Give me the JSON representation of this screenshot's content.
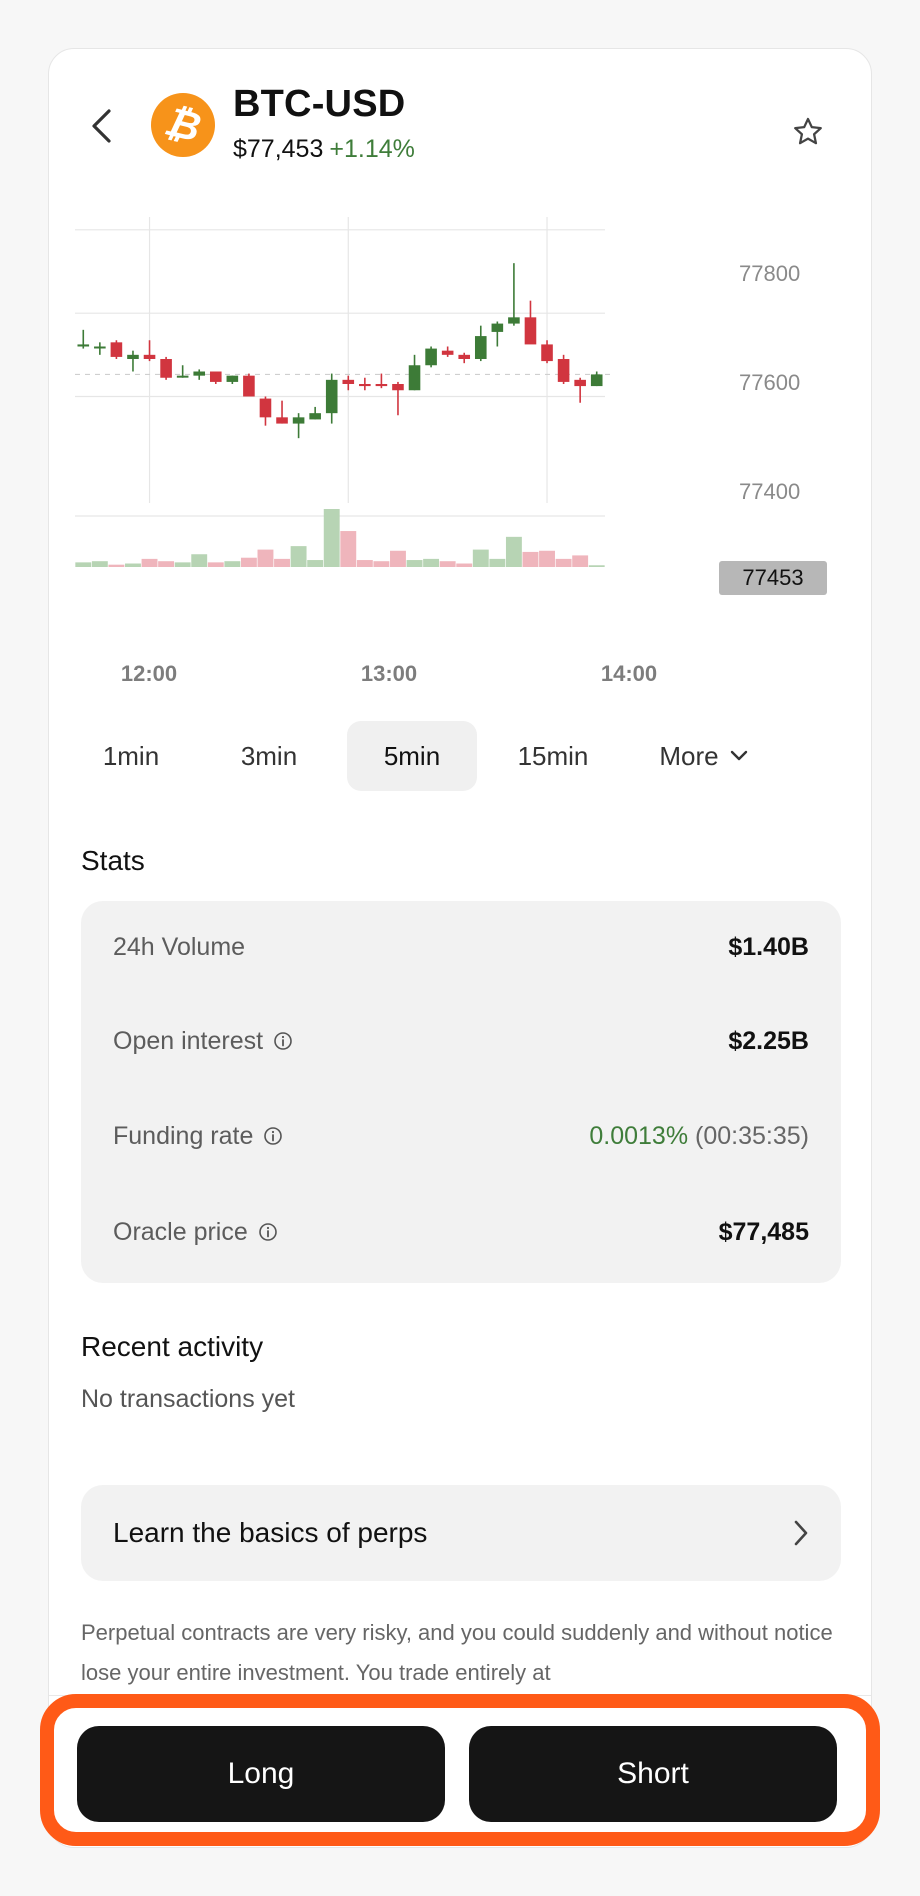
{
  "header": {
    "symbol": "BTC-USD",
    "coin_glyph": "₿",
    "price": "$77,453",
    "change": "+1.14%",
    "back_icon": "chevron-left-icon",
    "favorite_icon": "star-outline-icon",
    "coin_icon": "bitcoin-logo"
  },
  "chart_data": {
    "type": "candlestick",
    "y_ticks": [
      "77800",
      "77600",
      "77400"
    ],
    "ylim": [
      77130,
      77850
    ],
    "x_ticks": [
      "12:00",
      "13:00",
      "14:00"
    ],
    "last_price_label": "77453",
    "last_price": 77453,
    "interval": "5min",
    "colors": {
      "up": "#3d7b37",
      "down": "#d1353f",
      "up_volume": "#b7d4b4",
      "down_volume": "#efb5bc"
    },
    "candles": [
      {
        "t": "11:40",
        "o": 77520,
        "h": 77560,
        "l": 77515,
        "c": 77525
      },
      {
        "t": "11:45",
        "o": 77520,
        "h": 77530,
        "l": 77500,
        "c": 77520
      },
      {
        "t": "11:50",
        "o": 77530,
        "h": 77535,
        "l": 77490,
        "c": 77495
      },
      {
        "t": "11:55",
        "o": 77490,
        "h": 77510,
        "l": 77460,
        "c": 77500
      },
      {
        "t": "12:00",
        "o": 77500,
        "h": 77535,
        "l": 77485,
        "c": 77490
      },
      {
        "t": "12:05",
        "o": 77490,
        "h": 77495,
        "l": 77440,
        "c": 77445
      },
      {
        "t": "12:10",
        "o": 77450,
        "h": 77475,
        "l": 77445,
        "c": 77450
      },
      {
        "t": "12:15",
        "o": 77450,
        "h": 77465,
        "l": 77440,
        "c": 77460
      },
      {
        "t": "12:20",
        "o": 77460,
        "h": 77460,
        "l": 77430,
        "c": 77435
      },
      {
        "t": "12:25",
        "o": 77435,
        "h": 77450,
        "l": 77430,
        "c": 77450
      },
      {
        "t": "12:30",
        "o": 77450,
        "h": 77455,
        "l": 77400,
        "c": 77400
      },
      {
        "t": "12:35",
        "o": 77395,
        "h": 77400,
        "l": 77330,
        "c": 77350
      },
      {
        "t": "12:40",
        "o": 77350,
        "h": 77390,
        "l": 77335,
        "c": 77335
      },
      {
        "t": "12:45",
        "o": 77335,
        "h": 77360,
        "l": 77300,
        "c": 77350
      },
      {
        "t": "12:50",
        "o": 77345,
        "h": 77375,
        "l": 77345,
        "c": 77360
      },
      {
        "t": "12:55",
        "o": 77360,
        "h": 77455,
        "l": 77335,
        "c": 77440
      },
      {
        "t": "13:00",
        "o": 77440,
        "h": 77450,
        "l": 77415,
        "c": 77430
      },
      {
        "t": "13:05",
        "o": 77430,
        "h": 77445,
        "l": 77415,
        "c": 77425
      },
      {
        "t": "13:10",
        "o": 77430,
        "h": 77455,
        "l": 77420,
        "c": 77425
      },
      {
        "t": "13:15",
        "o": 77430,
        "h": 77435,
        "l": 77355,
        "c": 77415
      },
      {
        "t": "13:20",
        "o": 77415,
        "h": 77500,
        "l": 77415,
        "c": 77475
      },
      {
        "t": "13:25",
        "o": 77475,
        "h": 77520,
        "l": 77470,
        "c": 77515
      },
      {
        "t": "13:30",
        "o": 77510,
        "h": 77520,
        "l": 77495,
        "c": 77500
      },
      {
        "t": "13:35",
        "o": 77500,
        "h": 77505,
        "l": 77480,
        "c": 77490
      },
      {
        "t": "13:40",
        "o": 77490,
        "h": 77570,
        "l": 77485,
        "c": 77545
      },
      {
        "t": "13:45",
        "o": 77555,
        "h": 77580,
        "l": 77520,
        "c": 77575
      },
      {
        "t": "13:50",
        "o": 77575,
        "h": 77720,
        "l": 77570,
        "c": 77590
      },
      {
        "t": "13:55",
        "o": 77590,
        "h": 77630,
        "l": 77530,
        "c": 77525
      },
      {
        "t": "14:00",
        "o": 77525,
        "h": 77535,
        "l": 77480,
        "c": 77485
      },
      {
        "t": "14:05",
        "o": 77490,
        "h": 77500,
        "l": 77430,
        "c": 77435
      },
      {
        "t": "14:10",
        "o": 77440,
        "h": 77445,
        "l": 77385,
        "c": 77425
      },
      {
        "t": "14:15",
        "o": 77425,
        "h": 77460,
        "l": 77425,
        "c": 77453
      }
    ],
    "volumes": [
      8,
      10,
      4,
      6,
      14,
      10,
      8,
      22,
      8,
      10,
      16,
      30,
      14,
      36,
      12,
      100,
      62,
      12,
      10,
      28,
      12,
      14,
      10,
      6,
      30,
      14,
      52,
      26,
      28,
      14,
      20,
      3
    ]
  },
  "intervals": {
    "options": [
      "1min",
      "3min",
      "5min",
      "15min",
      "More"
    ],
    "selected": "5min",
    "more_icon": "chevron-down-icon"
  },
  "stats": {
    "title": "Stats",
    "volume_label": "24h Volume",
    "volume_value": "$1.40B",
    "oi_label": "Open interest",
    "oi_value": "$2.25B",
    "funding_label": "Funding rate",
    "funding_value": "0.0013%",
    "funding_timer": "(00:35:35)",
    "oracle_label": "Oracle price",
    "oracle_value": "$77,485",
    "info_icon": "info-circle-icon"
  },
  "activity": {
    "title": "Recent activity",
    "empty": "No transactions yet"
  },
  "learn": {
    "label": "Learn the basics of perps",
    "icon": "chevron-right-icon"
  },
  "disclaimer": "Perpetual contracts are very risky, and you could suddenly and without notice lose your entire investment. You trade entirely at",
  "actions": {
    "long": "Long",
    "short": "Short",
    "highlight_color": "#ff5a17"
  }
}
